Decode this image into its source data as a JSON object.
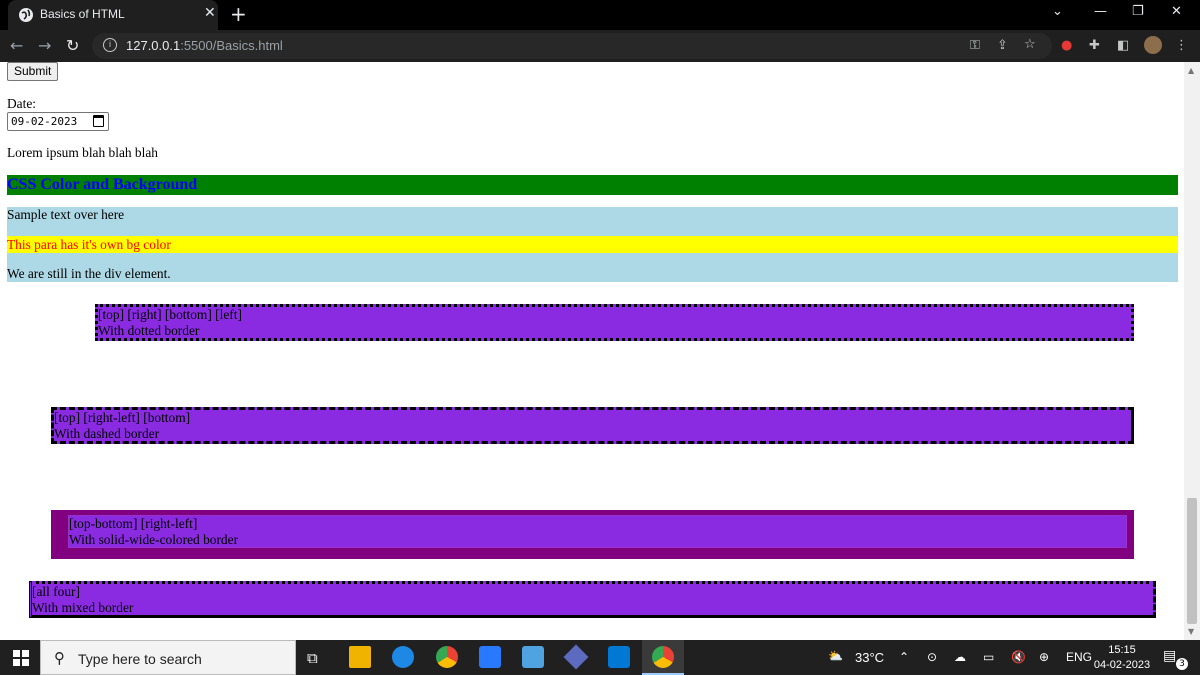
{
  "browser": {
    "tab_title": "Basics of HTML",
    "new_tab_label": "+",
    "url_host": "127.0.0.1",
    "url_path": ":5500/Basics.html"
  },
  "page": {
    "submit_label": "Submit",
    "date_label": "Date:",
    "date_value": "09-02-2023",
    "lorem": "Lorem ipsum blah blah blah",
    "css_heading": "CSS Color and Background",
    "sample_text": "Sample text over here",
    "yellow_para": "This para has it's own bg color",
    "still_div": "We are still in the div element.",
    "boxes": [
      {
        "line1": "[top] [right] [bottom] [left]",
        "line2": "With dotted border"
      },
      {
        "line1": "[top] [right-left] [bottom]",
        "line2": "With dashed border"
      },
      {
        "line1": "[top-bottom] [right-left]",
        "line2": "With solid-wide-colored border"
      },
      {
        "line1": "[all four]",
        "line2": "With mixed border"
      }
    ]
  },
  "taskbar": {
    "search_placeholder": "Type here to search",
    "temperature": "33°C",
    "language": "ENG",
    "time": "15:15",
    "date": "04-02-2023",
    "notification_count": "3"
  },
  "colors": {
    "heading_bg": "#008000",
    "heading_text": "#0000ff",
    "div_bg": "#add8e6",
    "para_bg": "#ffff00",
    "para_text": "#ff0000",
    "box_bg": "#8a2be2",
    "solid_border": "#800080"
  }
}
